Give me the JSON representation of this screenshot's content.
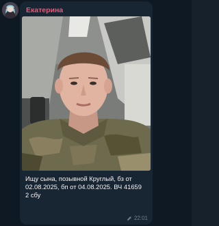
{
  "message": {
    "sender_name": "Екатерина",
    "caption_lines": [
      "Ищу сына, позывной Круглый, бз от",
      "02.08.2025, бп от 04.08.2025. ВЧ 41659",
      "2 сбу"
    ],
    "time": "22:01",
    "icons": {
      "avatar": "avatar-icon",
      "edited": "pencil-icon"
    }
  },
  "colors": {
    "sender_name": "#e45b79",
    "bubble": "#182533",
    "background": "#0f1923",
    "caption_text": "#f5f5f5",
    "meta_text": "#6d7f8f"
  }
}
